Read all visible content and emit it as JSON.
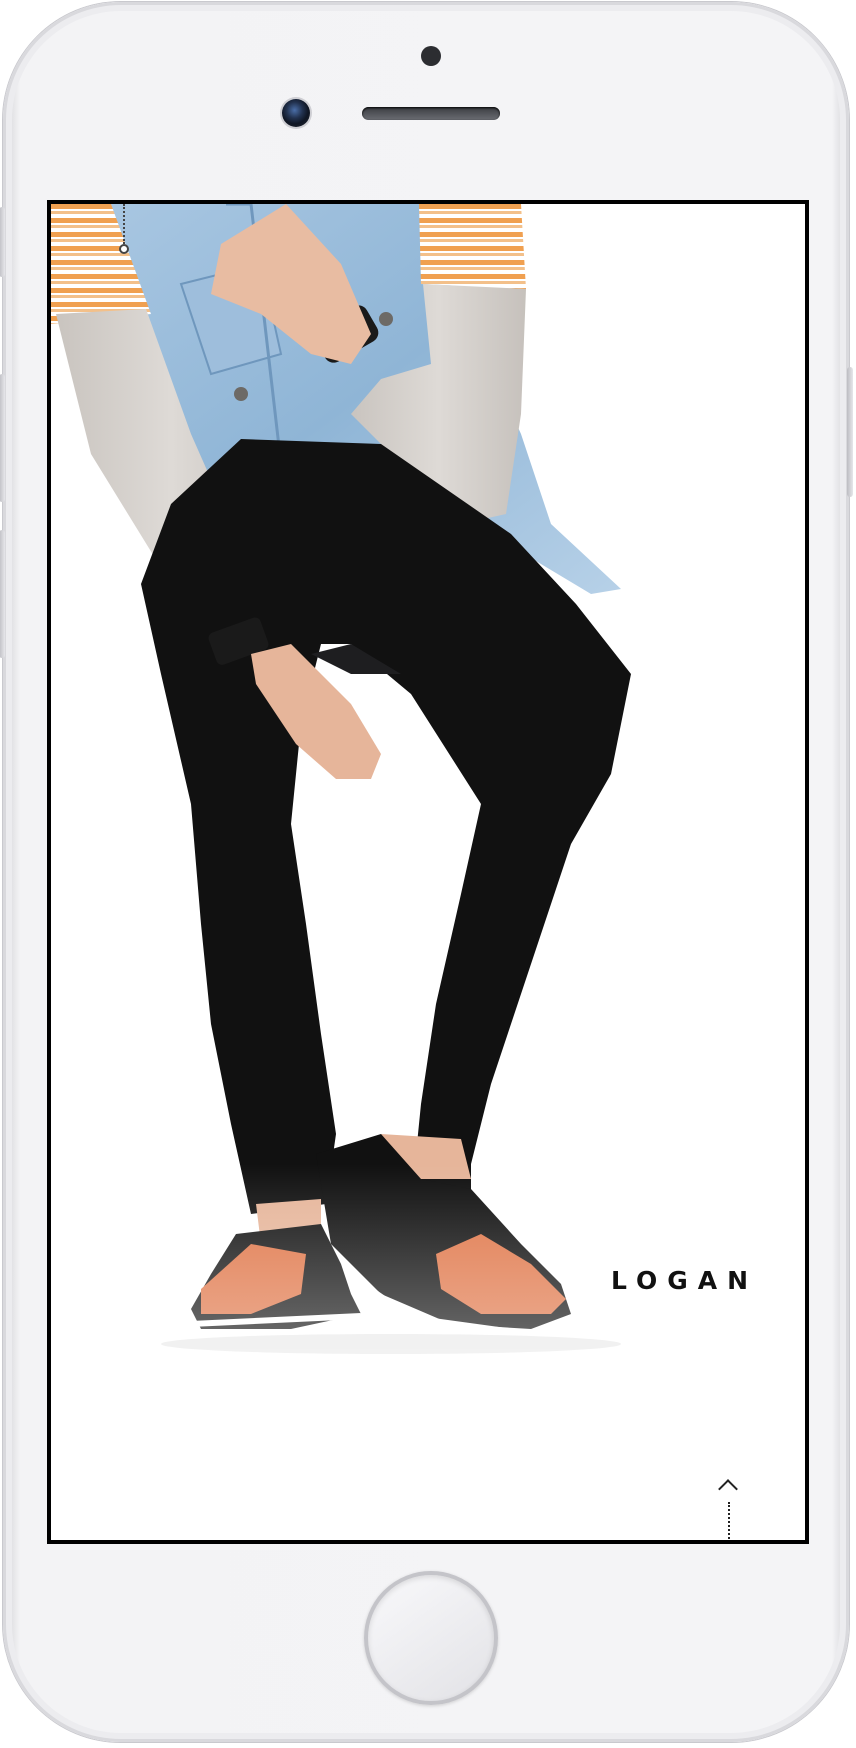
{
  "screen": {
    "brand_name": "LOGAN"
  },
  "icons": {
    "scroll_up": "chevron-up-icon",
    "top_indicator": "scroll-indicator-icon"
  },
  "colors": {
    "denim": "#8fb5d6",
    "stripe_orange": "#f0a050",
    "sleeve_grey": "#d6d1cc",
    "jeans_black": "#111111",
    "shoe_orange": "#e0774a",
    "skin": "#e6b59a"
  }
}
